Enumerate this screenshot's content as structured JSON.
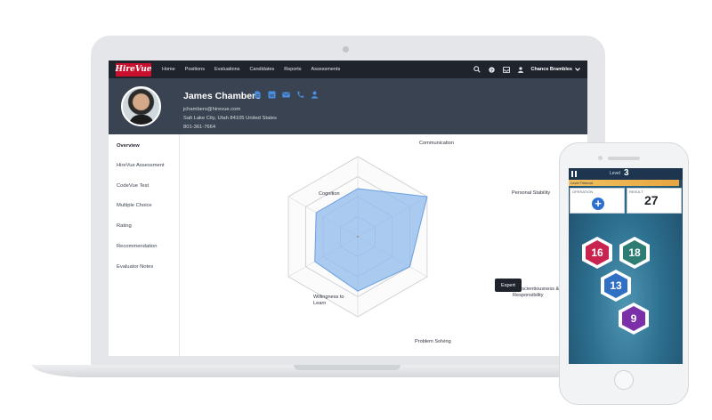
{
  "app": {
    "logo_text": "HireVue",
    "nav": [
      "Home",
      "Positions",
      "Evaluations",
      "Candidates",
      "Reports",
      "Assessments"
    ],
    "user_name": "Chance Brambles"
  },
  "candidate": {
    "name": "James Chambers",
    "email": "jchambers@hirevue.com",
    "location": "Salt Lake City, Utah 84105 United States",
    "phone": "801-361-7664",
    "icons": [
      "document-icon",
      "linkedin-icon",
      "mail-icon",
      "phone-icon",
      "person-icon"
    ]
  },
  "sidebar": {
    "items": [
      "Overview",
      "HireVue Assessment",
      "CodeVue Test",
      "Multiple Choice",
      "Rating",
      "Recommendation",
      "Evaluator Notes"
    ],
    "active": "Overview"
  },
  "radar": {
    "axes": [
      "Communication",
      "Personal Stability",
      "Conscientiousness & Responsibility",
      "Problem Solving",
      "Willingness to Learn",
      "Cognition"
    ],
    "values": [
      0.6,
      1.0,
      0.75,
      0.68,
      0.62,
      0.6
    ],
    "rings": 4,
    "tooltip": "Expert",
    "fill_color": "#8fb9ec",
    "stroke_color": "#6a9fe0"
  },
  "game": {
    "level_label": "Level",
    "level": "3",
    "timer_label": "Level Timeout",
    "timer_remaining": 0.97,
    "operation_label": "OPERATION",
    "operation": "+",
    "result_label": "RESULT",
    "result": "27",
    "tiles": [
      {
        "value": "16",
        "color": "#c8244f"
      },
      {
        "value": "18",
        "color": "#2e7d74"
      },
      {
        "value": "13",
        "color": "#2f6fc4"
      },
      {
        "value": "9",
        "color": "#7b2fa8"
      }
    ]
  }
}
